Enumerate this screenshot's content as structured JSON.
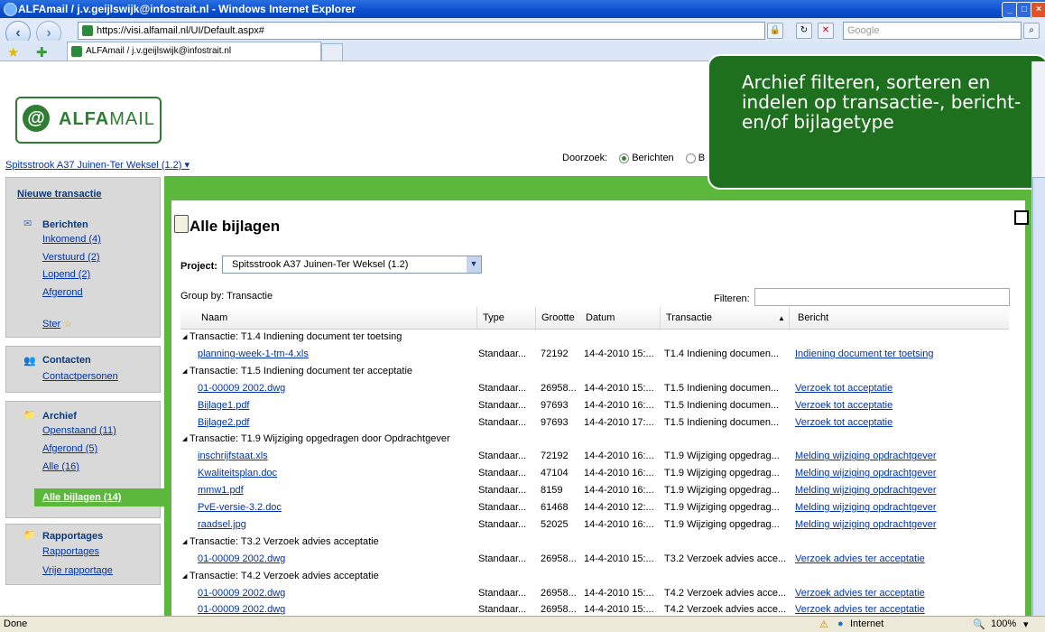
{
  "window": {
    "title": "ALFAmail / j.v.geijlswijk@infostrait.nl - Windows Internet Explorer"
  },
  "browser": {
    "url": "https://visi.alfamail.nl/UI/Default.aspx#",
    "search_placeholder": "Google",
    "tab_title": "ALFAmail / j.v.geijlswijk@infostrait.nl"
  },
  "app": {
    "logo_prefix": "ALFA",
    "logo_suffix": "MAIL",
    "project_selector": "Spitsstrook A37 Juinen-Ter Weksel (1.2)",
    "search_scope_label": "Doorzoek:",
    "search_scope_options": [
      "Berichten",
      "B"
    ]
  },
  "sidebar": {
    "new_transaction": "Nieuwe transactie",
    "berichten": {
      "title": "Berichten",
      "items": [
        "Inkomend (4)",
        "Verstuurd (2)",
        "Lopend (2)",
        "Afgerond"
      ],
      "star": "Ster"
    },
    "contacten": {
      "title": "Contacten",
      "items": [
        "Contactpersonen"
      ]
    },
    "archief": {
      "title": "Archief",
      "items": [
        "Openstaand (11)",
        "Afgerond (5)",
        "Alle (16)"
      ],
      "active": "Alle bijlagen (14)"
    },
    "rapportages": {
      "title": "Rapportages",
      "items": [
        "Rapportages",
        "Vrije rapportage"
      ]
    }
  },
  "main": {
    "title": "Alle bijlagen",
    "project_label": "Project:",
    "project_value": "Spitsstrook A37 Juinen-Ter Weksel (1.2)",
    "group_by": "Group by: Transactie",
    "filter_label": "Filteren:",
    "columns": [
      "Naam",
      "Type",
      "Grootte",
      "Datum",
      "Transactie",
      "Bericht"
    ]
  },
  "rows": [
    {
      "group": "Transactie: T1.4 Indiening document ter toetsing"
    },
    {
      "naam": "planning-week-1-tm-4.xls",
      "type": "Standaar...",
      "grootte": "72192",
      "datum": "14-4-2010 15:...",
      "transactie": "T1.4 Indiening documen...",
      "bericht": "Indiening document ter toetsing"
    },
    {
      "group": "Transactie: T1.5 Indiening document ter acceptatie"
    },
    {
      "naam": "01-00009 2002.dwg",
      "type": "Standaar...",
      "grootte": "26958...",
      "datum": "14-4-2010 15:...",
      "transactie": "T1.5 Indiening documen...",
      "bericht": "Verzoek tot acceptatie"
    },
    {
      "naam": "Bijlage1.pdf",
      "type": "Standaar...",
      "grootte": "97693",
      "datum": "14-4-2010 16:...",
      "transactie": "T1.5 Indiening documen...",
      "bericht": "Verzoek tot acceptatie"
    },
    {
      "naam": "Bijlage2.pdf",
      "type": "Standaar...",
      "grootte": "97693",
      "datum": "14-4-2010 17:...",
      "transactie": "T1.5 Indiening documen...",
      "bericht": "Verzoek tot acceptatie"
    },
    {
      "group": "Transactie: T1.9 Wijziging opgedragen door Opdrachtgever"
    },
    {
      "naam": "inschrijfstaat.xls",
      "type": "Standaar...",
      "grootte": "72192",
      "datum": "14-4-2010 16:...",
      "transactie": "T1.9 Wijziging opgedrag...",
      "bericht": "Melding wijziging opdrachtgever"
    },
    {
      "naam": "Kwaliteitsplan.doc",
      "type": "Standaar...",
      "grootte": "47104",
      "datum": "14-4-2010 16:...",
      "transactie": "T1.9 Wijziging opgedrag...",
      "bericht": "Melding wijziging opdrachtgever"
    },
    {
      "naam": "mmw1.pdf",
      "type": "Standaar...",
      "grootte": "8159",
      "datum": "14-4-2010 16:...",
      "transactie": "T1.9 Wijziging opgedrag...",
      "bericht": "Melding wijziging opdrachtgever"
    },
    {
      "naam": "PvE-versie-3.2.doc",
      "type": "Standaar...",
      "grootte": "61468",
      "datum": "14-4-2010 12:...",
      "transactie": "T1.9 Wijziging opgedrag...",
      "bericht": "Melding wijziging opdrachtgever"
    },
    {
      "naam": "raadsel.jpg",
      "type": "Standaar...",
      "grootte": "52025",
      "datum": "14-4-2010 16:...",
      "transactie": "T1.9 Wijziging opgedrag...",
      "bericht": "Melding wijziging opdrachtgever"
    },
    {
      "group": "Transactie: T3.2 Verzoek advies acceptatie"
    },
    {
      "naam": "01-00009 2002.dwg",
      "type": "Standaar...",
      "grootte": "26958...",
      "datum": "14-4-2010 15:...",
      "transactie": "T3.2 Verzoek advies acce...",
      "bericht": "Verzoek advies ter acceptatie"
    },
    {
      "group": "Transactie: T4.2 Verzoek advies acceptatie"
    },
    {
      "naam": "01-00009 2002.dwg",
      "type": "Standaar...",
      "grootte": "26958...",
      "datum": "14-4-2010 15:...",
      "transactie": "T4.2 Verzoek advies acce...",
      "bericht": "Verzoek advies ter acceptatie"
    },
    {
      "naam": "01-00009 2002.dwg",
      "type": "Standaar...",
      "grootte": "26958...",
      "datum": "14-4-2010 15:...",
      "transactie": "T4.2 Verzoek advies acce...",
      "bericht": "Verzoek advies ter acceptatie"
    }
  ],
  "callout": {
    "text": "Archief filteren, sorteren en indelen op transactie-, bericht- en/of bijlagetype"
  },
  "status": {
    "left": "Done",
    "zone": "Internet",
    "zoom": "100%"
  },
  "colors": {
    "brand_green": "#5cb83c",
    "dark_green": "#1e6f1e",
    "link": "#0033aa"
  }
}
